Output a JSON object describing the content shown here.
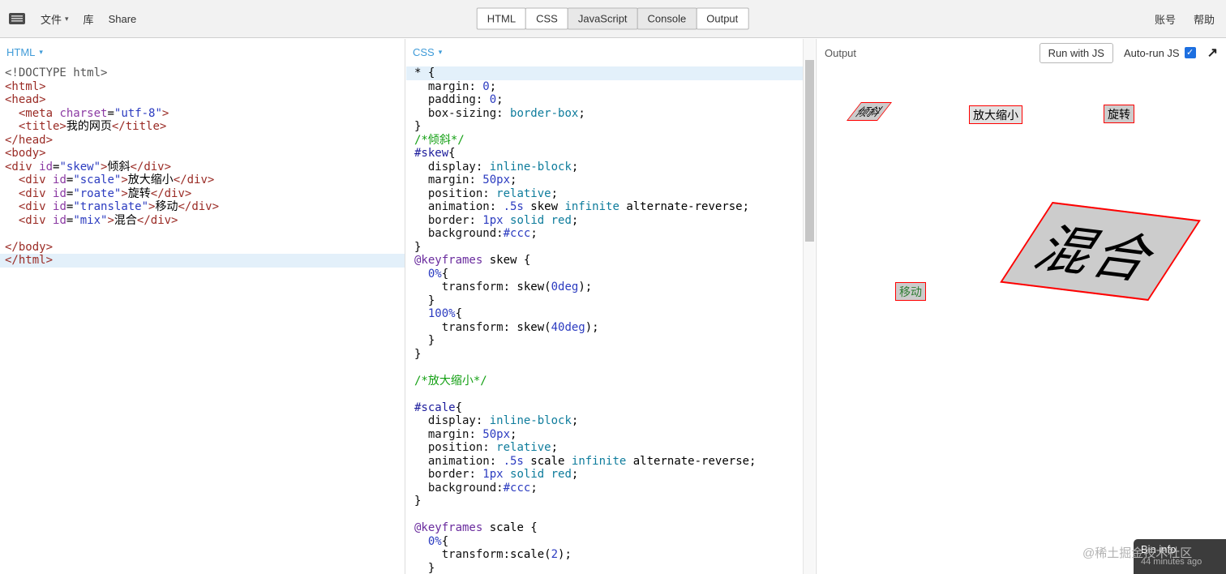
{
  "icons": {
    "caret": "▾",
    "arrow": "↗",
    "check": "✓"
  },
  "colors": {
    "panel_label_blue": "#3f9bd8",
    "checkbox_blue": "#1d6fe0",
    "active_line_highlight": "#e3f0fa",
    "output_box_border": "#ff0000",
    "output_box_bg": "#cccccc",
    "translate_text_green": "#2e7d32",
    "bin_info_bg": "#3c3c3c"
  },
  "topbar": {
    "menu": [
      {
        "label": "文件"
      },
      {
        "label": "库"
      },
      {
        "label": "Share"
      }
    ],
    "tabs": [
      {
        "label": "HTML",
        "active": true
      },
      {
        "label": "CSS",
        "active": true
      },
      {
        "label": "JavaScript",
        "active": false
      },
      {
        "label": "Console",
        "active": false
      },
      {
        "label": "Output",
        "active": true
      }
    ],
    "right": [
      "账号",
      "帮助"
    ]
  },
  "html_panel": {
    "title": "HTML",
    "lines": [
      {
        "t": [
          [
            "meta",
            "<!DOCTYPE html>"
          ]
        ]
      },
      {
        "t": [
          [
            "tag",
            "<html>"
          ]
        ]
      },
      {
        "t": [
          [
            "tag",
            "<head>"
          ]
        ]
      },
      {
        "t": [
          [
            "pln",
            "  "
          ],
          [
            "tag",
            "<meta"
          ],
          [
            "pln",
            " "
          ],
          [
            "attr",
            "charset"
          ],
          [
            "pln",
            "="
          ],
          [
            "str",
            "\"utf-8\""
          ],
          [
            "tag",
            ">"
          ]
        ]
      },
      {
        "t": [
          [
            "pln",
            "  "
          ],
          [
            "tag",
            "<title>"
          ],
          [
            "pln",
            "我的网页"
          ],
          [
            "tag",
            "</title>"
          ]
        ]
      },
      {
        "t": [
          [
            "tag",
            "</head>"
          ]
        ]
      },
      {
        "t": [
          [
            "tag",
            "<body>"
          ]
        ]
      },
      {
        "t": [
          [
            "tag",
            "<div"
          ],
          [
            "pln",
            " "
          ],
          [
            "attr",
            "id"
          ],
          [
            "pln",
            "="
          ],
          [
            "str",
            "\"skew\""
          ],
          [
            "tag",
            ">"
          ],
          [
            "pln",
            "倾斜"
          ],
          [
            "tag",
            "</div>"
          ]
        ]
      },
      {
        "t": [
          [
            "pln",
            "  "
          ],
          [
            "tag",
            "<div"
          ],
          [
            "pln",
            " "
          ],
          [
            "attr",
            "id"
          ],
          [
            "pln",
            "="
          ],
          [
            "str",
            "\"scale\""
          ],
          [
            "tag",
            ">"
          ],
          [
            "pln",
            "放大缩小"
          ],
          [
            "tag",
            "</div>"
          ]
        ]
      },
      {
        "t": [
          [
            "pln",
            "  "
          ],
          [
            "tag",
            "<div"
          ],
          [
            "pln",
            " "
          ],
          [
            "attr",
            "id"
          ],
          [
            "pln",
            "="
          ],
          [
            "str",
            "\"roate\""
          ],
          [
            "tag",
            ">"
          ],
          [
            "pln",
            "旋转"
          ],
          [
            "tag",
            "</div>"
          ]
        ]
      },
      {
        "t": [
          [
            "pln",
            "  "
          ],
          [
            "tag",
            "<div"
          ],
          [
            "pln",
            " "
          ],
          [
            "attr",
            "id"
          ],
          [
            "pln",
            "="
          ],
          [
            "str",
            "\"translate\""
          ],
          [
            "tag",
            ">"
          ],
          [
            "pln",
            "移动"
          ],
          [
            "tag",
            "</div>"
          ]
        ]
      },
      {
        "t": [
          [
            "pln",
            "  "
          ],
          [
            "tag",
            "<div"
          ],
          [
            "pln",
            " "
          ],
          [
            "attr",
            "id"
          ],
          [
            "pln",
            "="
          ],
          [
            "str",
            "\"mix\""
          ],
          [
            "tag",
            ">"
          ],
          [
            "pln",
            "混合"
          ],
          [
            "tag",
            "</div>"
          ]
        ]
      },
      {
        "t": []
      },
      {
        "t": [
          [
            "tag",
            "</body>"
          ]
        ]
      },
      {
        "hl": true,
        "t": [
          [
            "tag",
            "</html>"
          ]
        ]
      }
    ]
  },
  "css_panel": {
    "title": "CSS",
    "lines": [
      {
        "hl": true,
        "t": [
          [
            "pln",
            "* {"
          ]
        ]
      },
      {
        "t": [
          [
            "pln",
            "  "
          ],
          [
            "prop",
            "margin"
          ],
          [
            "pln",
            ": "
          ],
          [
            "num",
            "0"
          ],
          [
            "pln",
            ";"
          ]
        ]
      },
      {
        "t": [
          [
            "pln",
            "  "
          ],
          [
            "prop",
            "padding"
          ],
          [
            "pln",
            ": "
          ],
          [
            "num",
            "0"
          ],
          [
            "pln",
            ";"
          ]
        ]
      },
      {
        "t": [
          [
            "pln",
            "  "
          ],
          [
            "prop",
            "box-sizing"
          ],
          [
            "pln",
            ": "
          ],
          [
            "kw",
            "border-box"
          ],
          [
            "pln",
            ";"
          ]
        ]
      },
      {
        "t": [
          [
            "pln",
            "}"
          ]
        ]
      },
      {
        "t": [
          [
            "com",
            "/*倾斜*/"
          ]
        ]
      },
      {
        "t": [
          [
            "sel",
            "#skew"
          ],
          [
            "pln",
            "{"
          ]
        ]
      },
      {
        "t": [
          [
            "pln",
            "  "
          ],
          [
            "prop",
            "display"
          ],
          [
            "pln",
            ": "
          ],
          [
            "kw",
            "inline-block"
          ],
          [
            "pln",
            ";"
          ]
        ]
      },
      {
        "t": [
          [
            "pln",
            "  "
          ],
          [
            "prop",
            "margin"
          ],
          [
            "pln",
            ": "
          ],
          [
            "num",
            "50px"
          ],
          [
            "pln",
            ";"
          ]
        ]
      },
      {
        "t": [
          [
            "pln",
            "  "
          ],
          [
            "prop",
            "position"
          ],
          [
            "pln",
            ": "
          ],
          [
            "kw",
            "relative"
          ],
          [
            "pln",
            ";"
          ]
        ]
      },
      {
        "t": [
          [
            "pln",
            "  "
          ],
          [
            "prop",
            "animation"
          ],
          [
            "pln",
            ": "
          ],
          [
            "num",
            ".5s"
          ],
          [
            "pln",
            " skew "
          ],
          [
            "kw",
            "infinite"
          ],
          [
            "pln",
            " alternate-reverse;"
          ]
        ]
      },
      {
        "t": [
          [
            "pln",
            "  "
          ],
          [
            "prop",
            "border"
          ],
          [
            "pln",
            ": "
          ],
          [
            "num",
            "1px"
          ],
          [
            "pln",
            " "
          ],
          [
            "kw",
            "solid"
          ],
          [
            "pln",
            " "
          ],
          [
            "kw",
            "red"
          ],
          [
            "pln",
            ";"
          ]
        ]
      },
      {
        "t": [
          [
            "pln",
            "  "
          ],
          [
            "prop",
            "background"
          ],
          [
            "pln",
            ":"
          ],
          [
            "num",
            "#ccc"
          ],
          [
            "pln",
            ";"
          ]
        ]
      },
      {
        "t": [
          [
            "pln",
            "}"
          ]
        ]
      },
      {
        "t": [
          [
            "def",
            "@keyframes"
          ],
          [
            "pln",
            " skew {"
          ]
        ]
      },
      {
        "t": [
          [
            "pln",
            "  "
          ],
          [
            "num",
            "0%"
          ],
          [
            "pln",
            "{"
          ]
        ]
      },
      {
        "t": [
          [
            "pln",
            "    "
          ],
          [
            "prop",
            "transform"
          ],
          [
            "pln",
            ": skew("
          ],
          [
            "num",
            "0deg"
          ],
          [
            "pln",
            ");"
          ]
        ]
      },
      {
        "t": [
          [
            "pln",
            "  }"
          ]
        ]
      },
      {
        "t": [
          [
            "pln",
            "  "
          ],
          [
            "num",
            "100%"
          ],
          [
            "pln",
            "{"
          ]
        ]
      },
      {
        "t": [
          [
            "pln",
            "    "
          ],
          [
            "prop",
            "transform"
          ],
          [
            "pln",
            ": skew("
          ],
          [
            "num",
            "40deg"
          ],
          [
            "pln",
            ");"
          ]
        ]
      },
      {
        "t": [
          [
            "pln",
            "  }"
          ]
        ]
      },
      {
        "t": [
          [
            "pln",
            "}"
          ]
        ]
      },
      {
        "t": []
      },
      {
        "t": [
          [
            "com",
            "/*放大缩小*/"
          ]
        ]
      },
      {
        "t": []
      },
      {
        "t": [
          [
            "sel",
            "#scale"
          ],
          [
            "pln",
            "{"
          ]
        ]
      },
      {
        "t": [
          [
            "pln",
            "  "
          ],
          [
            "prop",
            "display"
          ],
          [
            "pln",
            ": "
          ],
          [
            "kw",
            "inline-block"
          ],
          [
            "pln",
            ";"
          ]
        ]
      },
      {
        "t": [
          [
            "pln",
            "  "
          ],
          [
            "prop",
            "margin"
          ],
          [
            "pln",
            ": "
          ],
          [
            "num",
            "50px"
          ],
          [
            "pln",
            ";"
          ]
        ]
      },
      {
        "t": [
          [
            "pln",
            "  "
          ],
          [
            "prop",
            "position"
          ],
          [
            "pln",
            ": "
          ],
          [
            "kw",
            "relative"
          ],
          [
            "pln",
            ";"
          ]
        ]
      },
      {
        "t": [
          [
            "pln",
            "  "
          ],
          [
            "prop",
            "animation"
          ],
          [
            "pln",
            ": "
          ],
          [
            "num",
            ".5s"
          ],
          [
            "pln",
            " scale "
          ],
          [
            "kw",
            "infinite"
          ],
          [
            "pln",
            " alternate-reverse;"
          ]
        ]
      },
      {
        "t": [
          [
            "pln",
            "  "
          ],
          [
            "prop",
            "border"
          ],
          [
            "pln",
            ": "
          ],
          [
            "num",
            "1px"
          ],
          [
            "pln",
            " "
          ],
          [
            "kw",
            "solid"
          ],
          [
            "pln",
            " "
          ],
          [
            "kw",
            "red"
          ],
          [
            "pln",
            ";"
          ]
        ]
      },
      {
        "t": [
          [
            "pln",
            "  "
          ],
          [
            "prop",
            "background"
          ],
          [
            "pln",
            ":"
          ],
          [
            "num",
            "#ccc"
          ],
          [
            "pln",
            ";"
          ]
        ]
      },
      {
        "t": [
          [
            "pln",
            "}"
          ]
        ]
      },
      {
        "t": []
      },
      {
        "t": [
          [
            "def",
            "@keyframes"
          ],
          [
            "pln",
            " scale {"
          ]
        ]
      },
      {
        "t": [
          [
            "pln",
            "  "
          ],
          [
            "num",
            "0%"
          ],
          [
            "pln",
            "{"
          ]
        ]
      },
      {
        "t": [
          [
            "pln",
            "    "
          ],
          [
            "prop",
            "transform"
          ],
          [
            "pln",
            ":scale("
          ],
          [
            "num",
            "2"
          ],
          [
            "pln",
            ");"
          ]
        ]
      },
      {
        "t": [
          [
            "pln",
            "  }"
          ]
        ]
      }
    ]
  },
  "output_panel": {
    "label": "Output",
    "run_button": "Run with JS",
    "autorun_label": "Auto-run JS",
    "autorun_checked": true,
    "boxes": {
      "skew": "倾斜",
      "scale": "放大缩小",
      "rotate": "旋转",
      "translate": "移动",
      "mix": "混合"
    },
    "watermark": "@稀土掘金技术社区",
    "bin_info": {
      "title": "Bin info",
      "time": "44 minutes ago"
    }
  }
}
